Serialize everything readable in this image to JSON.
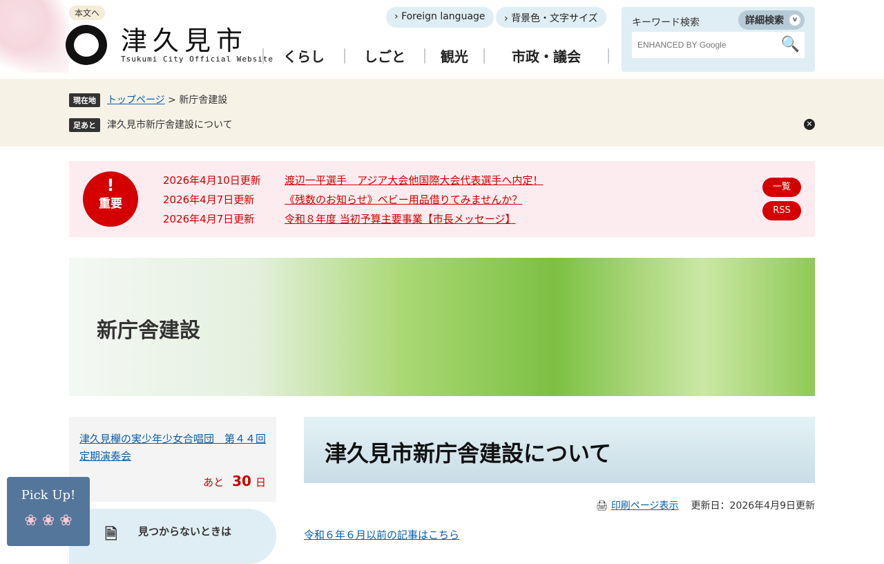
{
  "header": {
    "skip": "本文へ",
    "logo_jp": "津久見市",
    "logo_en": "Tsukumi City Official Website",
    "foreign": "Foreign language",
    "accessibility": "背景色・文字サイズ",
    "nav": [
      "くらし",
      "しごと",
      "観光",
      "市政・議会"
    ]
  },
  "search": {
    "label": "キーワード検索",
    "advanced": "詳細検索",
    "placeholder": "ENHANCED BY Google"
  },
  "breadcrumb": {
    "tag": "現在地",
    "home": "トップページ",
    "sep": " > ",
    "current": "新庁舎建設",
    "history_tag": "足あと",
    "history": "津久見市新庁舎建設について"
  },
  "alert": {
    "badge_mark": "!",
    "badge": "重要",
    "items": [
      {
        "date": "2026年4月10日更新",
        "title": "渡辺一平選手　アジア大会他国際大会代表選手へ内定！"
      },
      {
        "date": "2026年4月7日更新",
        "title": "《残数のお知らせ》ベビー用品借りてみませんか？"
      },
      {
        "date": "2026年4月7日更新",
        "title": "令和８年度 当初予算主要事業【市長メッセージ】"
      }
    ],
    "list": "一覧",
    "rss": "RSS"
  },
  "hero": {
    "title": "新庁舎建設"
  },
  "sidebar": {
    "event": "津久見欅の実少年少女合唱団　第４４回定期演奏会",
    "remain_prefix": "あと",
    "remain_days": "30",
    "remain_unit": "日",
    "notfound": "見つからないときは",
    "pickup": "Pick Up!"
  },
  "main": {
    "title": "津久見市新庁舎建設について",
    "print": "印刷ページ表示",
    "updated": "更新日：2026年4月9日更新",
    "link": "令和６年６月以前の記事はこちら"
  }
}
